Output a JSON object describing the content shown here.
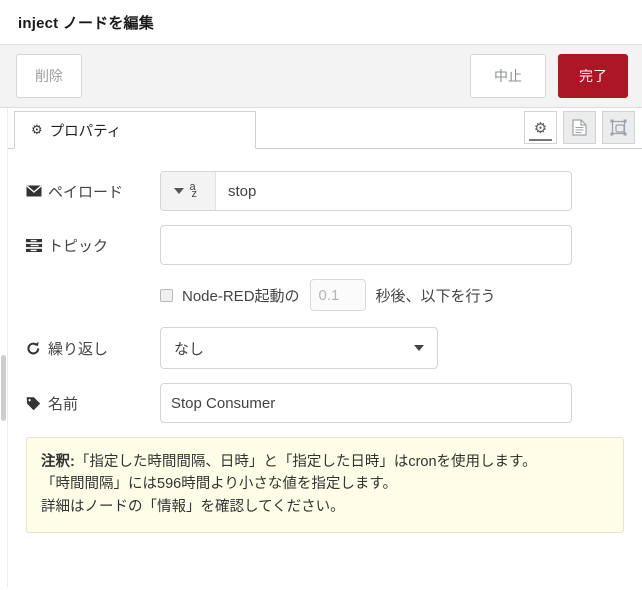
{
  "header": {
    "title": "inject ノードを編集"
  },
  "toolbar": {
    "delete_label": "削除",
    "cancel_label": "中止",
    "done_label": "完了",
    "done_color": "#ad1625"
  },
  "tabs": [
    {
      "label": "プロパティ",
      "icon": "gear-icon",
      "active": true
    }
  ],
  "tab_tools": [
    {
      "name": "properties-tool",
      "icon": "gear-icon",
      "active": true
    },
    {
      "name": "description-tool",
      "icon": "document-icon",
      "active": false
    },
    {
      "name": "appearance-tool",
      "icon": "appearance-icon",
      "active": false
    }
  ],
  "form": {
    "payload": {
      "label": "ペイロード",
      "icon": "envelope-icon",
      "type_icon": "string-type-icon",
      "type_glyph_top": "a",
      "type_glyph_bottom": "z",
      "value": "stop"
    },
    "topic": {
      "label": "トピック",
      "icon": "list-icon",
      "value": "",
      "placeholder": ""
    },
    "startup": {
      "checked": false,
      "text_before": "Node-RED起動の",
      "delay_value": "0.1",
      "text_after": "秒後、以下を行う"
    },
    "repeat": {
      "label": "繰り返し",
      "icon": "refresh-icon",
      "selected": "なし",
      "options": [
        "なし"
      ]
    },
    "name": {
      "label": "名前",
      "icon": "tag-icon",
      "value": "Stop Consumer",
      "placeholder": ""
    }
  },
  "note": {
    "prefix": "注釈:",
    "line1": "「指定した時間間隔、日時」と「指定した日時」はcronを使用します。",
    "line2": "「時間間隔」には596時間より小さな値を指定します。",
    "line3": "詳細はノードの「情報」を確認してください。"
  }
}
